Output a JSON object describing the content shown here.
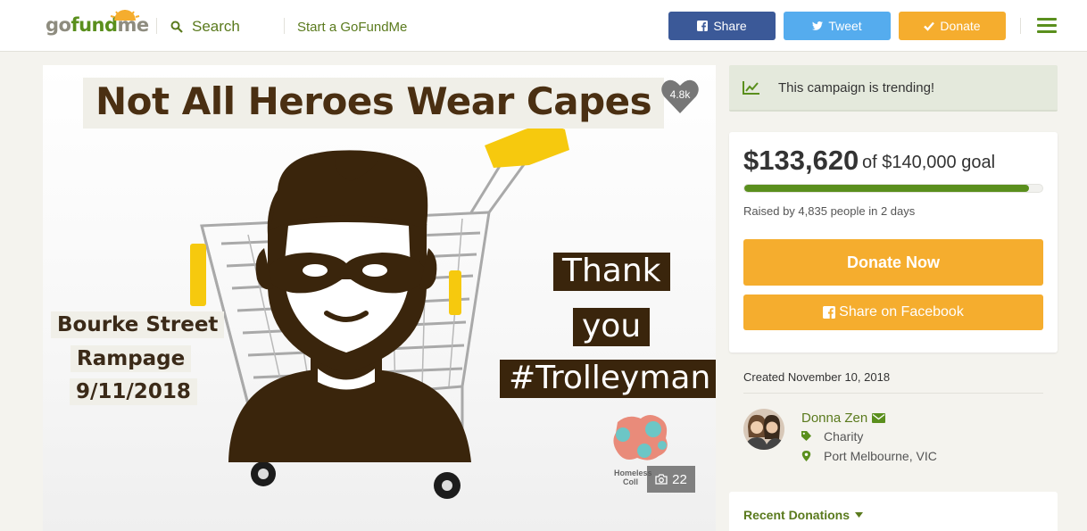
{
  "header": {
    "logo": {
      "part1": "go",
      "part2": "fund",
      "part3": "me"
    },
    "search_label": "Search",
    "start_label": "Start a GoFundMe",
    "share_label": "Share",
    "tweet_label": "Tweet",
    "donate_label": "Donate",
    "colors": {
      "facebook": "#3b5998",
      "twitter": "#55acee",
      "donate": "#f5ad2e",
      "brand_green": "#5a8f1d"
    }
  },
  "hero": {
    "title": "Not All Heroes Wear Capes",
    "heart_count": "4.8k",
    "left_tags": [
      "Bourke Street",
      "Rampage",
      "9/11/2018"
    ],
    "right_tags": [
      "Thank",
      "you",
      "#Trolleyman"
    ],
    "charity_logo_text": [
      "Homeless",
      "Coll"
    ],
    "photo_count": "22"
  },
  "sidebar": {
    "trending_text": "This campaign is trending!",
    "amount_raised": "$133,620",
    "goal_text": "of $140,000 goal",
    "progress_fraction": 0.954,
    "raised_by": "Raised by 4,835 people in 2 days",
    "donate_now_label": "Donate Now",
    "share_facebook_label": "Share on Facebook",
    "created": "Created November 10, 2018",
    "organizer_name": "Donna Zen",
    "category": "Charity",
    "location": "Port Melbourne, VIC",
    "recent_donations_label": "Recent Donations"
  }
}
